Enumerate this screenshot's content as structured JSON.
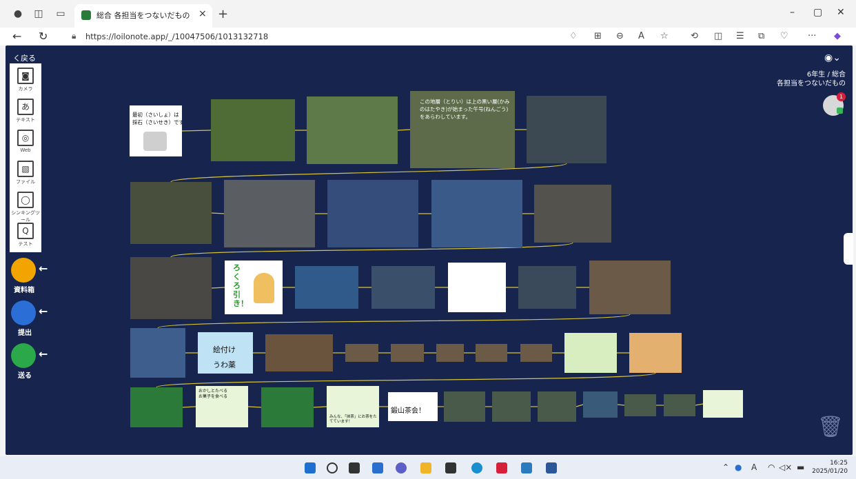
{
  "browser": {
    "tab_title": "総合 各担当をつないだもの",
    "tab_close": "×",
    "new_tab": "+",
    "url": "https://loilonote.app/_/10047506/1013132718",
    "win_min": "–",
    "win_max": "▢",
    "win_close": "✕",
    "more": "···"
  },
  "app": {
    "back_label": "く戻る",
    "tools": [
      {
        "label": "カメラ",
        "glyph": "◙"
      },
      {
        "label": "テキスト",
        "glyph": "あ"
      },
      {
        "label": "Web",
        "glyph": "◎"
      },
      {
        "label": "ファイル",
        "glyph": "▧"
      },
      {
        "label": "シンキングツール",
        "glyph": "◯"
      },
      {
        "label": "テスト",
        "glyph": "Q"
      }
    ],
    "side_buttons": [
      {
        "label": "資料箱",
        "color": "#f2a400"
      },
      {
        "label": "提出",
        "color": "#2b6fd6"
      },
      {
        "label": "送る",
        "color": "#2aa84a"
      }
    ],
    "grade_line1": "6年生 / 総合",
    "grade_line2": "各担当をつないだもの",
    "badge_count": "1"
  },
  "cards": {
    "r1c1": "最初（さいしょ）は\n採石（さいせき）です。",
    "r1c4": "この地層（とりい）は上の黒い層(かみ\nのはたやき)が始まった午号(ねんごう)\nをあらわしています。",
    "r3c2": "ろくろ引き！",
    "r4c2a": "絵付け",
    "r4c2b": "うわ薬",
    "r5c2": "おかしとたべる\nお菓子を食べる",
    "r5c4": "みんな、「抹茶」にお茶をたてています！",
    "r5c5": "鍛山茶会！"
  },
  "taskbar": {
    "time": "16:25",
    "date": "2025/01/20",
    "ime": "A"
  },
  "colors": {
    "board_bg": "#16244e",
    "connector": "#d9c53a"
  }
}
